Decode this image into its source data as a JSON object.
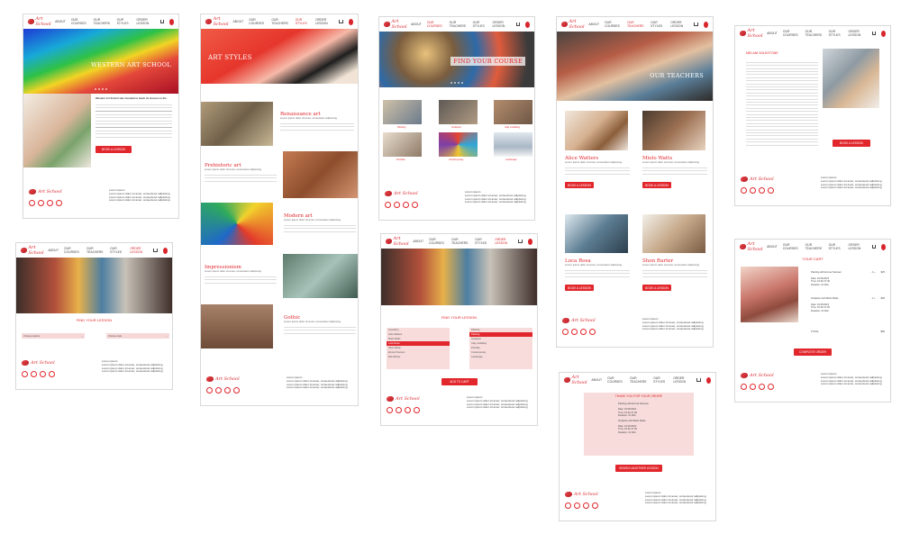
{
  "brand": {
    "logo_text": "Art School",
    "accent": "#e1262c"
  },
  "nav": {
    "about": "ABOUT",
    "courses": "OUR COURSES",
    "teachers": "OUR TEACHERS",
    "styles": "OUR STYLES",
    "order": "ORDER LESSON"
  },
  "footer": {
    "heading": "Lorem ipsum",
    "lines": [
      "Lorem ipsum dolor sit amet, consectetur adipiscing",
      "Lorem ipsum dolor sit amet, consectetur adipiscing",
      "Lorem ipsum dolor sit amet, consectetur adipiscing"
    ],
    "small": "Lorem ipsum",
    "small2": "Lorem ipsum dolor sit amet, consectetur adipiscing"
  },
  "home": {
    "hero_title": "WESTERN ART SCHOOL",
    "intro_heading": "Western Art School was founded to teach its lessons to the",
    "button": "BOOK A LESSON"
  },
  "styles_page": {
    "hero_title": "ART STYLES",
    "items": [
      {
        "title": "Renaissance art",
        "sub": "Lorem ipsum dolor sit amet, consectetur adipiscing"
      },
      {
        "title": "Prehistoric art",
        "sub": "Lorem ipsum dolor sit amet, consectetur adipiscing"
      },
      {
        "title": "Modern art",
        "sub": "Lorem ipsum dolor sit amet, consectetur adipiscing"
      },
      {
        "title": "Impressionism",
        "sub": "Lorem ipsum dolor sit amet, consectetur adipiscing"
      },
      {
        "title": "Gothic",
        "sub": "Lorem ipsum dolor sit amet, consectetur adipiscing"
      }
    ]
  },
  "courses_page": {
    "hero_title": "FIND YOUR COURSE",
    "items": [
      "Painting",
      "Sculpture",
      "Clay modelling",
      "Portraits",
      "Contemporary",
      "Landscape"
    ]
  },
  "teachers_page": {
    "hero_title": "OUR TEACHERS",
    "teachers": [
      {
        "name": "Alice Watters",
        "sub": "Lorem ipsum dolor sit amet, consectetur adipiscing"
      },
      {
        "name": "Mielo Watts",
        "sub": "Lorem ipsum dolor sit amet, consectetur adipiscing"
      },
      {
        "name": "Loca Rosa",
        "sub": "Lorem ipsum dolor sit amet, consectetur adipiscing"
      },
      {
        "name": "Shon Rarter",
        "sub": "Lorem ipsum dolor sit amet, consectetur adipiscing"
      }
    ],
    "button": "BOOK A LESSON"
  },
  "teacher_detail": {
    "name": "MELANI WILDSTONE",
    "button": "BOOK A LESSON"
  },
  "find_lesson": {
    "title": "FIND YOUR LESSON",
    "select_a": "Choose teacher",
    "select_b": "Choose style"
  },
  "find_lesson_open": {
    "title": "FIND YOUR LESSON",
    "teachers": [
      "Lisa Moro",
      "Alice Watters",
      "Mielo Watts",
      "Loca Rosa",
      "Shon Rarter",
      "Emma Townsen",
      "Bob Mirrow"
    ],
    "styles": [
      "Painting",
      "Painting",
      "Sculpture",
      "Clay modelling",
      "Portraits",
      "Contemporary",
      "Landscape"
    ],
    "button": "ADD TO CART"
  },
  "cart": {
    "title": "YOUR CART",
    "items": [
      {
        "name": "Painting with Emma Townsen",
        "price": "$25",
        "date": "Date: 15.08.2023",
        "time": "Time: 16.00-17.00",
        "duration": "Duration: 1h 30m"
      },
      {
        "name": "Sculpture with Mielo Watts",
        "price": "$25",
        "date": "Date: 16.08.2023",
        "time": "Time: 16.00-17.00",
        "duration": "Duration: 1h 30m"
      }
    ],
    "total_label": "TOTAL",
    "total": "$50",
    "button": "COMPLETE ORDER"
  },
  "thanks": {
    "title": "THANK YOU FOR YOUR ORDER!",
    "item1": "Painting with Emma Townsen",
    "item1_date": "Date: 15.08.2023",
    "item1_time": "Time: 16.00-17.00",
    "item1_dur": "Duration: 1h 30m",
    "item2": "Sculpture with Mielo Watts",
    "item2_date": "Date: 16.08.2023",
    "item2_time": "Time: 16.00-17.00",
    "item2_dur": "Duration: 1h 30m",
    "button": "SEARCH ANOTHER LESSON"
  }
}
